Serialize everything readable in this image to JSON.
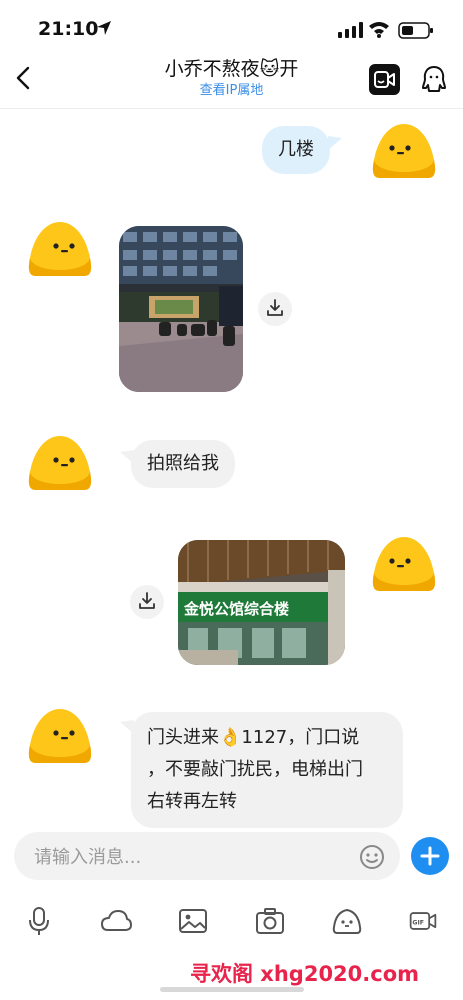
{
  "status_bar": {
    "time": "21:10",
    "icons": [
      "location-arrow-icon",
      "signal-icon",
      "wifi-icon",
      "battery-icon"
    ]
  },
  "header": {
    "title": "小乔不熬夜🐱开",
    "subtitle": "查看IP属地",
    "back_icon": "chevron-left-icon",
    "video_icon": "video-call-icon",
    "profile_icon": "profile-icon"
  },
  "messages": [
    {
      "side": "right",
      "type": "text",
      "text": "几楼"
    },
    {
      "side": "left",
      "type": "image",
      "description_icon": "photo-building-front"
    },
    {
      "side": "left",
      "type": "text",
      "text": "拍照给我"
    },
    {
      "side": "right",
      "type": "image",
      "description_icon": "photo-storefront"
    },
    {
      "side": "left",
      "type": "text",
      "lines": [
        "门头进来👌1127，门口说",
        "，不要敲门扰民，电梯出门",
        "右转再左转"
      ]
    }
  ],
  "storefront_sign": "金悦公馆综合楼",
  "input": {
    "placeholder": "请输入消息...",
    "value": ""
  },
  "toolbar": {
    "items": [
      "microphone-icon",
      "cloud-icon",
      "image-icon",
      "camera-icon",
      "sticker-icon",
      "gif-icon"
    ]
  },
  "watermark": "寻欢阁 xhg2020.com",
  "colors": {
    "accent_blue": "#1e8ff0",
    "right_bubble": "#dff0fd",
    "left_bubble": "#f1f1f1",
    "subtitle_blue": "#3a8ee6",
    "avatar_yellow": "#ffc61a",
    "watermark_red": "#e8244c"
  }
}
